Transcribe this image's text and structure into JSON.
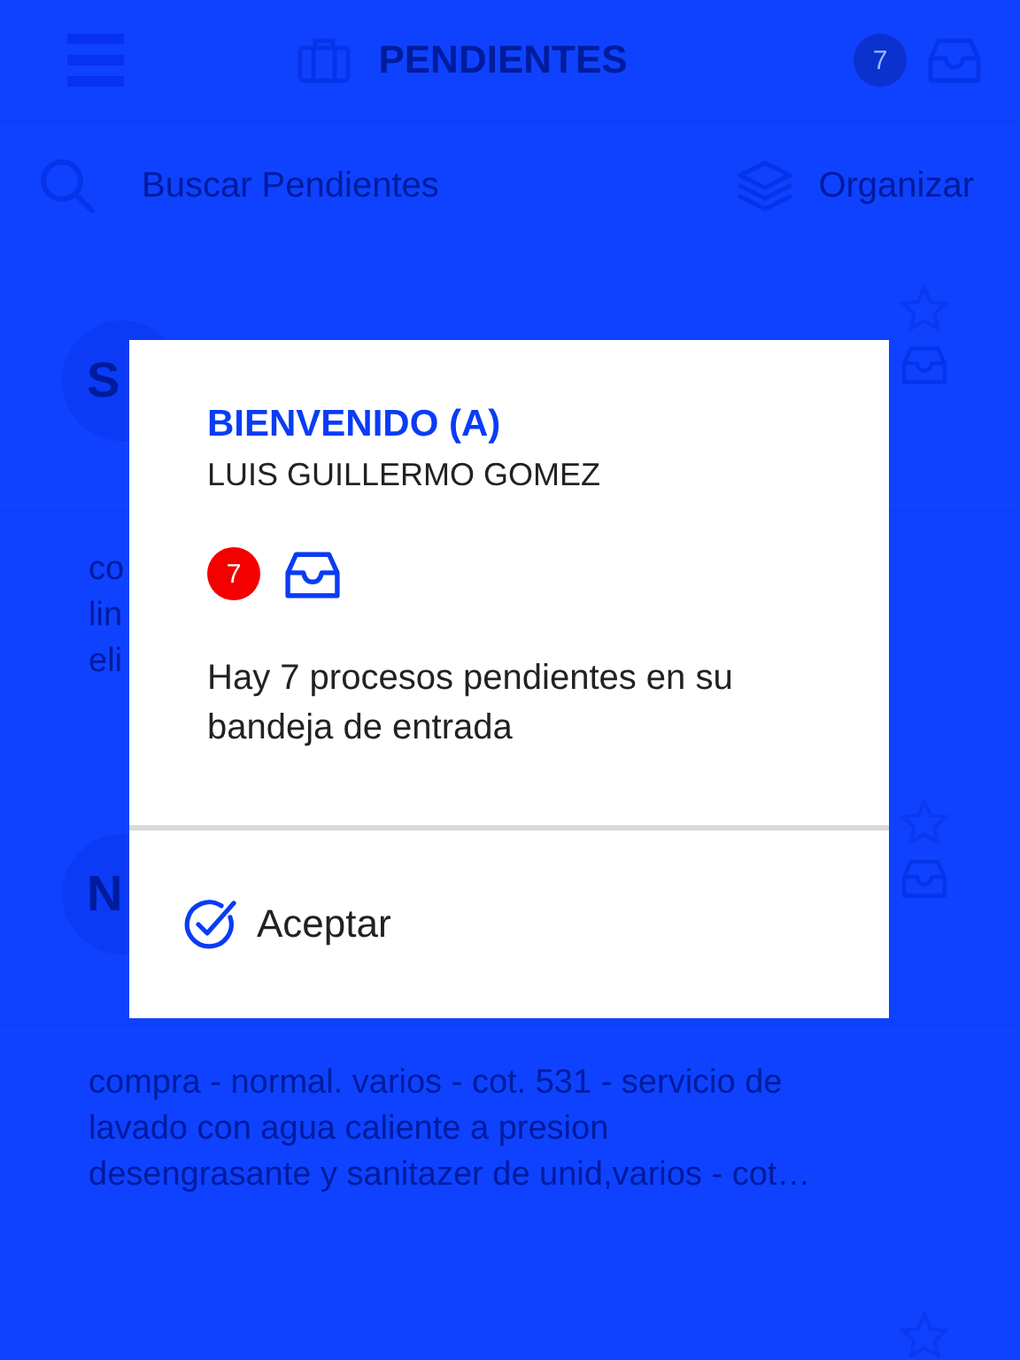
{
  "header": {
    "title": "PENDIENTES",
    "badge": "7"
  },
  "search": {
    "placeholder": "Buscar Pendientes"
  },
  "organize": {
    "label": "Organizar"
  },
  "items": [
    {
      "initials": "S",
      "description_lines": [
        "co",
        "lin",
        "eli"
      ]
    },
    {
      "initials": "N",
      "description_lines": [
        "compra - normal. varios - cot. 531 - servicio de",
        "lavado con agua caliente a presion",
        "desengrasante y sanitazer de unid,varios - cot…"
      ]
    }
  ],
  "dialog": {
    "title": "BIENVENIDO (A)",
    "user": "LUIS GUILLERMO GOMEZ",
    "badge": "7",
    "message": "Hay 7 procesos pendientes en su bandeja de entrada",
    "accept": "Aceptar"
  }
}
